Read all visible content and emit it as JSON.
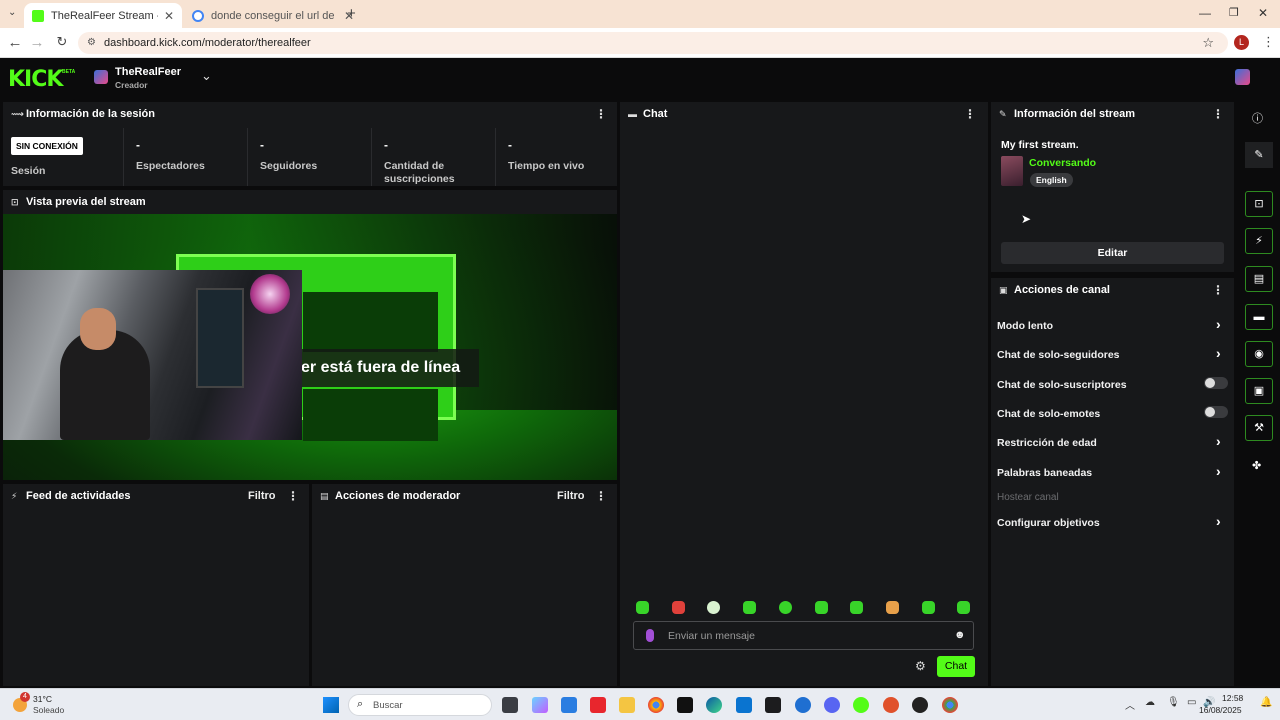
{
  "browser": {
    "tabs": [
      {
        "title": "TheRealFeer Stream - Kick Dash",
        "active": true
      },
      {
        "title": "donde conseguir el url de kick",
        "active": false
      }
    ],
    "url": "dashboard.kick.com/moderator/therealfeer",
    "profile_letter": "L"
  },
  "header": {
    "channel_name": "TheRealFeer",
    "role": "Creador",
    "logo": "KICK",
    "logo_tag": "BETA"
  },
  "session": {
    "title": "Información de la sesión",
    "status_badge": "SIN CONEXIÓN",
    "status_label": "Sesión",
    "stats": [
      {
        "value": "-",
        "label": "Espectadores"
      },
      {
        "value": "-",
        "label": "Seguidores"
      },
      {
        "value": "-",
        "label": "Cantidad de suscripciones"
      },
      {
        "value": "-",
        "label": "Tiempo en vivo"
      }
    ]
  },
  "preview": {
    "title": "Vista previa del stream",
    "offline_text": "er está fuera de línea"
  },
  "activity": {
    "title": "Feed de actividades",
    "filter": "Filtro"
  },
  "modactions": {
    "title": "Acciones de moderador",
    "filter": "Filtro"
  },
  "chat": {
    "title": "Chat",
    "placeholder": "Enviar un mensaje",
    "send_label": "Chat"
  },
  "stream_info": {
    "title": "Información del stream",
    "stream_title": "My first stream.",
    "category": "Conversando",
    "language": "English",
    "edit_label": "Editar"
  },
  "channel_actions": {
    "title": "Acciones de canal",
    "items": [
      {
        "label": "Modo lento",
        "control": "chevron"
      },
      {
        "label": "Chat de solo-seguidores",
        "control": "chevron"
      },
      {
        "label": "Chat de solo-suscriptores",
        "control": "toggle"
      },
      {
        "label": "Chat de solo-emotes",
        "control": "toggle"
      },
      {
        "label": "Restricción de edad",
        "control": "chevron"
      },
      {
        "label": "Palabras baneadas",
        "control": "chevron"
      },
      {
        "label": "Hostear canal",
        "control": "none"
      },
      {
        "label": "Configurar objetivos",
        "control": "chevron"
      }
    ]
  },
  "taskbar": {
    "weather_temp": "31°C",
    "weather_desc": "Soleado",
    "weather_badge": "4",
    "search_placeholder": "Buscar",
    "time": "12:58",
    "date": "16/08/2025"
  },
  "colors": {
    "accent": "#53fc18",
    "panel": "#17181a",
    "bg": "#0b0b0c"
  }
}
